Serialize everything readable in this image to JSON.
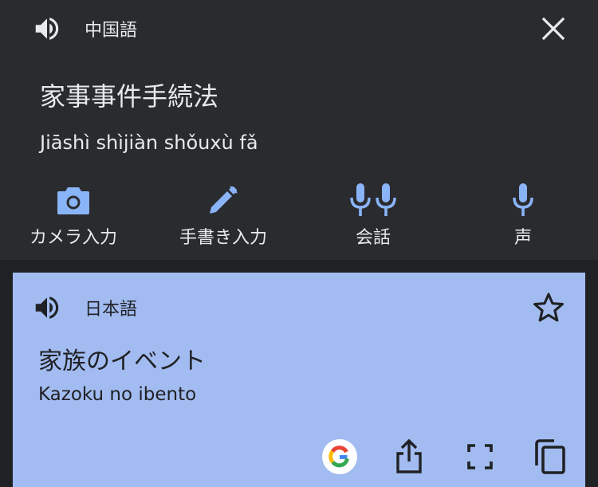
{
  "source": {
    "language": "中国語",
    "text": "家事事件手続法",
    "pinyin": "Jiāshì shìjiàn shǒuxù fǎ"
  },
  "tools": [
    {
      "label": "カメラ入力",
      "icon": "camera-icon"
    },
    {
      "label": "手書き入力",
      "icon": "pen-icon"
    },
    {
      "label": "会話",
      "icon": "double-mic-icon"
    },
    {
      "label": "声",
      "icon": "mic-icon"
    }
  ],
  "target": {
    "language": "日本語",
    "text": "家族のイベント",
    "romaji": "Kazoku no ibento"
  },
  "colors": {
    "background": "#2a2b2f",
    "accent_blue": "#8ab4f8",
    "card": "#a2bcf1"
  }
}
